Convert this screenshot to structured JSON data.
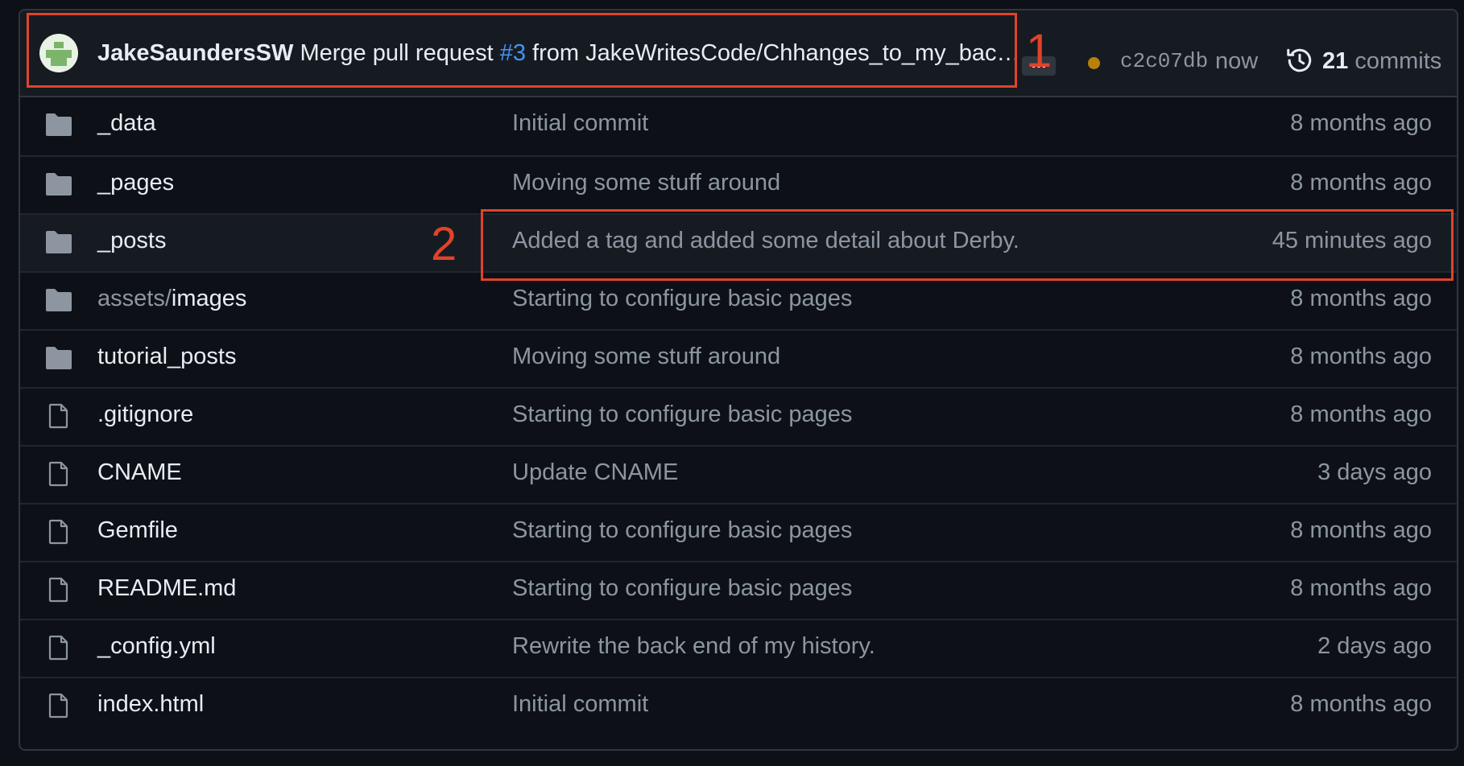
{
  "commit": {
    "author": "JakeSaundersSW",
    "message_before": "Merge pull request ",
    "pr_link": "#3",
    "message_after": " from JakeWritesCode/Chhanges_to_my_bac…",
    "ellipsis_label": "…",
    "sha": "c2c07db",
    "when": "now",
    "commit_count": "21",
    "commits_label": "commits"
  },
  "files": [
    {
      "type": "folder",
      "name": "_data",
      "message": "Initial commit",
      "age": "8 months ago"
    },
    {
      "type": "folder",
      "name": "_pages",
      "message": "Moving some stuff around",
      "age": "8 months ago"
    },
    {
      "type": "folder",
      "name": "_posts",
      "message": "Added a tag and added some detail about Derby.",
      "age": "45 minutes ago"
    },
    {
      "type": "folder",
      "prefix": "assets/",
      "name": "images",
      "message": "Starting to configure basic pages",
      "age": "8 months ago"
    },
    {
      "type": "folder",
      "name": "tutorial_posts",
      "message": "Moving some stuff around",
      "age": "8 months ago"
    },
    {
      "type": "file",
      "name": ".gitignore",
      "message": "Starting to configure basic pages",
      "age": "8 months ago"
    },
    {
      "type": "file",
      "name": "CNAME",
      "message": "Update CNAME",
      "age": "3 days ago"
    },
    {
      "type": "file",
      "name": "Gemfile",
      "message": "Starting to configure basic pages",
      "age": "8 months ago"
    },
    {
      "type": "file",
      "name": "README.md",
      "message": "Starting to configure basic pages",
      "age": "8 months ago"
    },
    {
      "type": "file",
      "name": "_config.yml",
      "message": "Rewrite the back end of my history.",
      "age": "2 days ago"
    },
    {
      "type": "file",
      "name": "index.html",
      "message": "Initial commit",
      "age": "8 months ago"
    }
  ],
  "annotations": {
    "label_1": "1",
    "label_2": "2"
  },
  "colors": {
    "background": "#0d1117",
    "link": "#4493f8",
    "annotation": "#e0432b",
    "status_pending": "#bb8009"
  },
  "icons": {
    "folder": "folder-icon",
    "file": "file-icon",
    "history": "history-icon"
  }
}
